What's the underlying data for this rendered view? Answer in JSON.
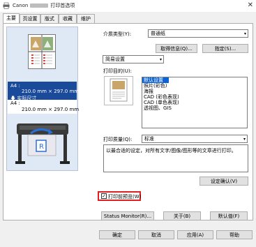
{
  "window": {
    "app_prefix": "Canon",
    "title_suffix": "打印首选项",
    "close_glyph": "✕"
  },
  "tabs": [
    {
      "label": "主要"
    },
    {
      "label": "页设置"
    },
    {
      "label": "版式"
    },
    {
      "label": "收藏"
    },
    {
      "label": "维护"
    }
  ],
  "preview": {
    "paper_top_label": "A4 :",
    "paper_top_size": "210.0 mm × 297.0 mm",
    "actual_size_label": "实际尺寸",
    "paper_bottom_label": "A4 :",
    "paper_bottom_size": "210.0 mm × 297.0 mm"
  },
  "media_type": {
    "label": "介质类型(Y):",
    "value": "普通纸"
  },
  "buttons": {
    "get_info": "取得信息(Q)...",
    "custom": "指定(S)...",
    "settings_confirm": "设定确认(V)",
    "status_monitor": "Status Monitor(R)...",
    "about": "关于(B)",
    "defaults": "默认值(F)",
    "ok": "确定",
    "cancel": "取消",
    "apply": "应用(A)",
    "help": "帮助"
  },
  "mode": {
    "value": "简易设置"
  },
  "print_target": {
    "label": "打印目的(U):",
    "items": [
      "默认设置",
      "照片(彩色)",
      "海报",
      "CAD (彩色表现)",
      "CAD (单色表现)",
      "透视图、GIS"
    ],
    "selected_index": 0
  },
  "print_quality": {
    "label": "打印质量(Q):",
    "value": "标准"
  },
  "description": {
    "text": "以最合适的设定，对所有文字/图像/图形等的文章进行打印。"
  },
  "preview_before_print": {
    "label": "打印前预览(W)",
    "checked": true
  },
  "colors": {
    "selection": "#0a64d8",
    "highlight_border": "#e02020",
    "preview_band": "#1a4a9a"
  },
  "icons": [
    "printer-icon",
    "close-icon",
    "dropdown-arrow-icon",
    "checkbox-checked-icon",
    "large-format-printer-icon",
    "document-thumbnail-icon"
  ]
}
